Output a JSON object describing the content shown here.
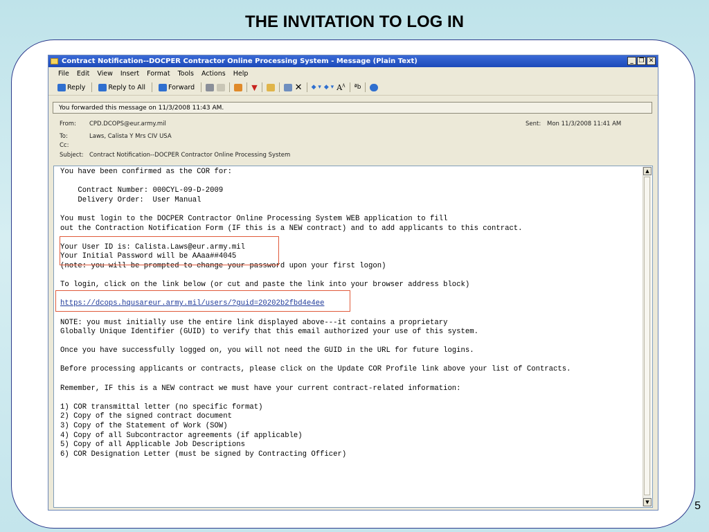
{
  "slide": {
    "title": "THE INVITATION TO LOG IN",
    "page_number": "5"
  },
  "window": {
    "title": "Contract Notification--DOCPER Contractor Online Processing System - Message (Plain Text)",
    "buttons": {
      "minimize": "_",
      "maximize": "❐",
      "close": "✕"
    }
  },
  "menu": [
    "File",
    "Edit",
    "View",
    "Insert",
    "Format",
    "Tools",
    "Actions",
    "Help"
  ],
  "toolbar": {
    "reply": "Reply",
    "reply_all": "Reply to All",
    "forward": "Forward",
    "icons": [
      "print-icon",
      "copy-icon",
      "move-icon",
      "flag-icon",
      "address-book-icon",
      "save-icon",
      "delete-icon",
      "previous-item-icon",
      "next-item-icon",
      "font-size-icon",
      "encoding-icon",
      "help-icon"
    ],
    "colors": {
      "reply": "#2f6fcf",
      "forward": "#2f6fcf",
      "flag": "#c8231e",
      "help": "#2f6fcf"
    }
  },
  "infobar": "You forwarded this message on 11/3/2008 11:43 AM.",
  "headers": {
    "from_label": "From:",
    "from_value": "CPD.DCOPS@eur.army.mil",
    "to_label": "To:",
    "to_value": "Laws, Calista Y Mrs CIV USA",
    "cc_label": "Cc:",
    "cc_value": "",
    "subject_label": "Subject:",
    "subject_value": "Contract Notification--DOCPER Contractor Online Processing System",
    "sent_label": "Sent:",
    "sent_value": "Mon 11/3/2008 11:41 AM"
  },
  "body": {
    "line1": "You have been confirmed as the COR for:",
    "contract_line": "    Contract Number: 000CYL-09-D-2009",
    "delivery_line": "    Delivery Order:  User Manual",
    "must_login_1": "You must login to the DOCPER Contractor Online Processing System WEB application to fill",
    "must_login_2": "out the Contraction Notification Form (IF this is a NEW contract) and to add applicants to this contract.",
    "userid_line": "Your User ID is: Calista.Laws@eur.army.mil",
    "password_line": "Your Initial Password will be AAaa##4045",
    "note_prompt": "(note: you will be prompted to change your password upon your first logon)",
    "to_login": "To login, click on the link below (or cut and paste the link into your browser address block)",
    "link": "https://dcops.hqusareur.army.mil/users/?guid=20202b2fbd4e4ee",
    "note1": "NOTE: you must initially use the entire link displayed above---it contains a proprietary",
    "note2": "Globally Unique Identifier (GUID) to verify that this email authorized your use of this system.",
    "once": "Once you have successfully logged on, you will not need the GUID in the URL for future logins.",
    "before": "Before processing applicants or contracts, please click on the Update COR Profile link above your list of Contracts.",
    "remember": "Remember, IF this is a NEW contract we must have your current contract-related information:",
    "items": [
      "1) COR transmittal letter (no specific format)",
      "2) Copy of the signed contract document",
      "3) Copy of the Statement of Work (SOW)",
      "4) Copy of all Subcontractor agreements (if applicable)",
      "5) Copy of all Applicable Job Descriptions",
      "6) COR Designation Letter (must be signed by Contracting Officer)"
    ]
  },
  "scrollbar": {
    "up": "▲",
    "down": "▼"
  },
  "colors": {
    "callout": "#e05a3a",
    "frame": "#2d3a8c",
    "titlebar": "#1c49b9"
  }
}
